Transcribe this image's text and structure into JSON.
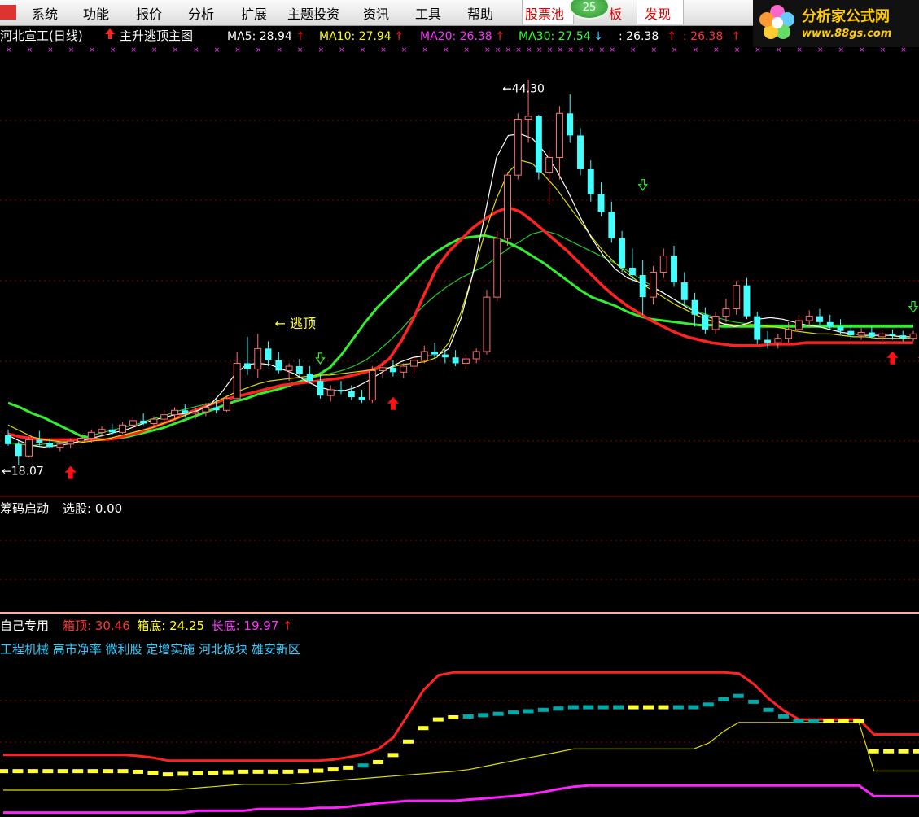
{
  "menubar": {
    "items": [
      "系统",
      "功能",
      "报价",
      "分析",
      "扩展",
      "主题投资",
      "资讯",
      "工具",
      "帮助",
      "股票池",
      "板",
      "发现"
    ],
    "badge": "25"
  },
  "logo": {
    "name": "分析家公式网",
    "url": "www.88gs.com"
  },
  "main_panel": {
    "title": "河北宣工(日线)",
    "indicator": "主升逃顶主图",
    "ma": [
      {
        "label": "MA5: 28.94",
        "arrow": "↑",
        "color": "#ffffff"
      },
      {
        "label": "MA10: 27.94",
        "arrow": "↑",
        "color": "#ffff00"
      },
      {
        "label": "MA20: 26.38",
        "arrow": "↑",
        "color": "#ff33ff"
      },
      {
        "label": "MA30: 27.54",
        "arrow": "↓",
        "color": "#33ff33"
      },
      {
        "label": ": 26.38",
        "arrow": "↑",
        "color": "#ffffff"
      },
      {
        "label": ": 26.38",
        "arrow": "↑",
        "color": "#ff3333"
      }
    ],
    "high_label": "44.30",
    "low_label": "18.07",
    "annotation": "← 逃顶"
  },
  "panel2": {
    "title": "筹码启动",
    "value_label": "选股: 0.00"
  },
  "panel3": {
    "title": "自己专用",
    "values": [
      {
        "label": "箱顶: 30.46",
        "color": "#ff3333"
      },
      {
        "label": "箱底: 24.25",
        "color": "#ffff00"
      },
      {
        "label": "长底: 19.97",
        "color": "#ff33ff"
      }
    ],
    "arrow": "↑",
    "tags": "工程机械 高市净率 微利股 定增实施 河北板块 雄安新区"
  },
  "colors": {
    "up": "#ff6666",
    "down": "#33ffff",
    "grid": "#8b0000",
    "text": "#dddddd"
  },
  "chart_data": [
    {
      "type": "candlestick",
      "title": "河北宣工(日线)",
      "ylim": [
        16.5,
        46.5
      ],
      "candles": [
        [
          20.1,
          20.5,
          19.4,
          19.5
        ],
        [
          19.5,
          19.7,
          18.07,
          18.7
        ],
        [
          18.7,
          20.0,
          18.6,
          19.8
        ],
        [
          19.8,
          20.4,
          19.4,
          19.6
        ],
        [
          19.6,
          19.9,
          19.2,
          19.3
        ],
        [
          19.3,
          19.7,
          19.0,
          19.5
        ],
        [
          19.5,
          19.9,
          19.2,
          19.7
        ],
        [
          19.7,
          20.2,
          19.5,
          19.9
        ],
        [
          19.9,
          20.5,
          19.6,
          20.3
        ],
        [
          20.3,
          20.7,
          20.0,
          20.5
        ],
        [
          20.5,
          20.9,
          20.1,
          20.3
        ],
        [
          20.3,
          21.0,
          20.2,
          20.8
        ],
        [
          20.8,
          21.3,
          20.5,
          21.1
        ],
        [
          21.1,
          21.6,
          20.8,
          20.9
        ],
        [
          20.9,
          21.4,
          20.6,
          21.2
        ],
        [
          21.2,
          21.8,
          20.9,
          21.5
        ],
        [
          21.5,
          22.0,
          21.2,
          21.8
        ],
        [
          21.8,
          22.2,
          21.3,
          21.6
        ],
        [
          21.6,
          22.0,
          21.2,
          21.7
        ],
        [
          21.7,
          22.3,
          21.4,
          22.0
        ],
        [
          22.0,
          22.6,
          21.6,
          21.8
        ],
        [
          21.8,
          22.8,
          21.7,
          22.6
        ],
        [
          22.6,
          25.8,
          22.4,
          25.0
        ],
        [
          25.0,
          26.8,
          24.2,
          24.6
        ],
        [
          24.6,
          27.0,
          24.0,
          26.0
        ],
        [
          26.0,
          26.5,
          24.8,
          25.2
        ],
        [
          25.2,
          25.8,
          24.3,
          24.5
        ],
        [
          24.5,
          25.0,
          23.8,
          24.8
        ],
        [
          24.8,
          25.3,
          24.1,
          24.3
        ],
        [
          24.3,
          24.8,
          23.6,
          23.8
        ],
        [
          23.8,
          24.3,
          22.6,
          22.8
        ],
        [
          22.8,
          23.5,
          22.4,
          23.2
        ],
        [
          23.2,
          23.8,
          22.9,
          23.1
        ],
        [
          23.1,
          23.5,
          22.5,
          22.7
        ],
        [
          22.7,
          23.2,
          22.3,
          22.5
        ],
        [
          22.5,
          24.8,
          22.3,
          24.5
        ],
        [
          24.5,
          25.0,
          24.0,
          24.7
        ],
        [
          24.7,
          25.2,
          24.1,
          24.4
        ],
        [
          24.4,
          25.0,
          24.0,
          24.8
        ],
        [
          24.8,
          25.5,
          24.3,
          25.2
        ],
        [
          25.2,
          26.2,
          25.0,
          25.8
        ],
        [
          25.8,
          26.4,
          25.3,
          25.6
        ],
        [
          25.6,
          26.0,
          25.0,
          25.4
        ],
        [
          25.4,
          25.9,
          24.8,
          25.0
        ],
        [
          25.0,
          25.6,
          24.6,
          25.3
        ],
        [
          25.3,
          26.0,
          25.0,
          25.8
        ],
        [
          25.8,
          30.0,
          25.6,
          29.5
        ],
        [
          29.5,
          34.0,
          29.2,
          33.5
        ],
        [
          33.5,
          38.0,
          33.0,
          37.8
        ],
        [
          37.8,
          42.0,
          37.5,
          41.6
        ],
        [
          41.6,
          44.3,
          40.0,
          41.8
        ],
        [
          41.8,
          41.9,
          37.5,
          38.0
        ],
        [
          38.0,
          39.5,
          35.8,
          39.0
        ],
        [
          39.0,
          42.5,
          37.5,
          42.0
        ],
        [
          42.0,
          43.3,
          40.0,
          40.5
        ],
        [
          40.5,
          41.0,
          37.8,
          38.2
        ],
        [
          38.2,
          38.8,
          36.0,
          36.5
        ],
        [
          36.5,
          37.3,
          35.0,
          35.3
        ],
        [
          35.3,
          36.0,
          33.2,
          33.5
        ],
        [
          33.5,
          34.0,
          31.2,
          31.5
        ],
        [
          31.5,
          32.8,
          30.5,
          31.0
        ],
        [
          31.0,
          32.0,
          28.3,
          29.5
        ],
        [
          29.5,
          31.6,
          29.0,
          31.2
        ],
        [
          31.2,
          32.8,
          30.8,
          32.3
        ],
        [
          32.3,
          33.0,
          30.2,
          30.5
        ],
        [
          30.5,
          31.2,
          29.0,
          29.3
        ],
        [
          29.3,
          29.8,
          27.5,
          28.3
        ],
        [
          28.3,
          28.8,
          27.0,
          27.3
        ],
        [
          27.3,
          28.5,
          27.0,
          28.2
        ],
        [
          28.2,
          29.4,
          27.8,
          28.7
        ],
        [
          28.7,
          30.6,
          28.3,
          30.3
        ],
        [
          30.3,
          30.8,
          28.0,
          28.2
        ],
        [
          28.2,
          28.5,
          26.3,
          26.6
        ],
        [
          26.6,
          27.2,
          26.0,
          26.4
        ],
        [
          26.4,
          27.0,
          26.0,
          26.7
        ],
        [
          26.7,
          27.8,
          26.4,
          27.3
        ],
        [
          27.3,
          28.3,
          27.0,
          27.9
        ],
        [
          27.9,
          28.6,
          27.4,
          28.2
        ],
        [
          28.2,
          28.7,
          27.6,
          27.8
        ],
        [
          27.8,
          28.3,
          27.3,
          27.5
        ],
        [
          27.5,
          28.0,
          27.0,
          27.2
        ],
        [
          27.2,
          27.6,
          26.6,
          26.9
        ],
        [
          26.9,
          27.4,
          26.6,
          27.1
        ],
        [
          27.1,
          27.5,
          26.7,
          26.8
        ],
        [
          26.8,
          27.3,
          26.5,
          27.0
        ],
        [
          27.0,
          27.3,
          26.6,
          26.9
        ],
        [
          26.9,
          27.2,
          26.5,
          26.7
        ],
        [
          26.7,
          27.2,
          26.5,
          27.0
        ]
      ],
      "ma5": [
        20.1,
        19.7,
        19.4,
        19.3,
        19.4,
        19.5,
        19.7,
        19.9,
        20.1,
        20.3,
        20.5,
        20.8,
        21.1,
        21.3,
        21.5,
        21.6,
        21.8,
        22.2,
        23.1,
        24.2,
        24.9,
        25.0,
        24.9,
        24.6,
        24.3,
        23.8,
        23.4,
        23.2,
        23.1,
        23.3,
        23.7,
        24.2,
        24.7,
        25.1,
        25.4,
        25.5,
        25.5,
        26.0,
        28.0,
        31.0,
        35.0,
        39.0,
        40.5,
        40.6,
        40.3,
        39.4,
        38.2,
        36.7,
        35.0,
        33.5,
        32.3,
        31.4,
        30.8,
        30.5,
        30.2,
        29.8,
        29.3,
        28.8,
        28.4,
        28.1,
        27.7,
        27.5,
        27.7,
        28.0,
        28.1,
        28.0,
        27.8,
        27.6,
        27.5,
        27.3,
        27.1,
        27.0,
        26.9,
        26.9,
        26.9,
        26.8,
        26.8
      ],
      "ma10": [
        20.8,
        20.4,
        20.0,
        19.8,
        19.7,
        19.6,
        19.6,
        19.7,
        19.8,
        20.0,
        20.2,
        20.4,
        20.6,
        20.9,
        21.2,
        21.5,
        21.8,
        22.2,
        22.6,
        23.0,
        23.3,
        23.6,
        23.8,
        23.9,
        24.0,
        24.1,
        24.2,
        24.2,
        24.3,
        24.4,
        24.5,
        24.6,
        24.7,
        24.9,
        25.0,
        25.1,
        25.4,
        26.4,
        28.4,
        31.0,
        33.8,
        36.2,
        38.0,
        38.8,
        38.6,
        37.8,
        36.9,
        35.8,
        34.7,
        33.6,
        32.6,
        31.8,
        31.1,
        30.5,
        30.0,
        29.5,
        29.0,
        28.6,
        28.2,
        27.9,
        27.7,
        27.6,
        27.6,
        27.6,
        27.5,
        27.4,
        27.2,
        27.1,
        27.0,
        27.0,
        26.9,
        26.8,
        26.8,
        26.7,
        26.7,
        26.7,
        26.7
      ],
      "ma20_red": [
        20.2,
        20.0,
        19.9,
        19.8,
        19.8,
        19.8,
        19.8,
        19.8,
        19.8,
        19.9,
        20.1,
        20.3,
        20.6,
        20.9,
        21.2,
        21.6,
        21.9,
        22.2,
        22.5,
        22.7,
        22.9,
        23.1,
        23.3,
        23.5,
        23.6,
        23.7,
        23.8,
        23.9,
        24.0,
        24.2,
        24.4,
        24.7,
        25.3,
        26.5,
        28.0,
        29.8,
        31.5,
        32.6,
        33.4,
        34.2,
        34.8,
        35.3,
        35.6,
        35.3,
        34.7,
        34.0,
        33.3,
        32.6,
        31.8,
        31.0,
        30.2,
        29.5,
        28.9,
        28.4,
        27.9,
        27.5,
        27.1,
        26.8,
        26.6,
        26.4,
        26.3,
        26.2,
        26.2,
        26.2,
        26.3,
        26.3,
        26.3,
        26.4,
        26.4,
        26.4,
        26.4,
        26.4,
        26.4,
        26.4,
        26.4,
        26.4,
        26.4
      ],
      "ma30_green": [
        22.3,
        22.0,
        21.6,
        21.3,
        20.9,
        20.5,
        20.1,
        19.9,
        19.8,
        19.9,
        20.0,
        20.2,
        20.4,
        20.6,
        20.9,
        21.2,
        21.5,
        21.8,
        22.1,
        22.4,
        22.6,
        22.9,
        23.1,
        23.3,
        23.6,
        23.9,
        24.2,
        24.7,
        25.6,
        26.7,
        27.8,
        28.8,
        29.6,
        30.4,
        31.2,
        32.0,
        32.6,
        33.1,
        33.5,
        33.6,
        33.7,
        33.5,
        33.2,
        32.8,
        32.3,
        31.8,
        31.2,
        30.6,
        30.0,
        29.5,
        29.2,
        28.9,
        28.5,
        28.2,
        28.0,
        27.9,
        27.8,
        27.7,
        27.6,
        27.6,
        27.5,
        27.5,
        27.5,
        27.5,
        27.5,
        27.5,
        27.5,
        27.5,
        27.5,
        27.5,
        27.5,
        27.5,
        27.5,
        27.5,
        27.5,
        27.5,
        27.5
      ],
      "ma_green_thin": [
        19.6,
        19.5,
        19.4,
        19.5,
        19.6,
        19.7,
        19.9,
        20.1,
        20.3,
        20.5,
        20.7,
        20.9,
        21.2,
        21.4,
        21.7,
        21.9,
        22.1,
        22.3,
        22.5,
        22.7,
        22.9,
        23.1,
        23.3,
        23.5,
        23.7,
        23.9,
        24.1,
        24.3,
        24.5,
        24.8,
        25.2,
        25.8,
        26.5,
        27.3,
        28.2,
        29.0,
        29.7,
        30.3,
        30.8,
        31.2,
        31.6,
        32.2,
        32.8,
        33.3,
        33.8,
        34.0,
        33.8,
        33.4,
        33.0,
        32.6,
        32.2,
        31.8,
        31.3,
        30.8,
        30.3,
        29.8,
        29.3,
        28.9,
        28.5,
        28.2,
        28.0,
        27.8,
        27.7,
        27.6,
        27.6,
        27.6,
        27.6,
        27.6,
        27.6,
        27.6,
        27.6,
        27.6,
        27.6,
        27.6,
        27.6,
        27.6,
        27.6
      ]
    },
    {
      "type": "line",
      "title": "自己专用",
      "ylim": [
        17.0,
        46.0
      ],
      "series": [
        {
          "name": "箱顶",
          "values": [
            27.0,
            27.0,
            27.0,
            27.0,
            27.0,
            27.0,
            27.0,
            27.0,
            27.0,
            26.8,
            26.5,
            26.0,
            26.0,
            26.0,
            26.0,
            26.0,
            26.0,
            26.0,
            26.0,
            26.0,
            26.0,
            26.0,
            26.2,
            26.6,
            27.1,
            28.0,
            30.0,
            34.0,
            38.0,
            40.5,
            41.0,
            41.0,
            41.0,
            41.0,
            41.0,
            41.0,
            41.0,
            41.0,
            41.0,
            41.0,
            41.0,
            41.0,
            41.0,
            41.0,
            41.0,
            41.0,
            41.0,
            41.0,
            41.0,
            40.8,
            39.0,
            36.5,
            34.5,
            33.0,
            33.0,
            33.0,
            33.0,
            33.0,
            30.46,
            30.46,
            30.46,
            30.46
          ]
        },
        {
          "name": "箱底",
          "values": [
            21.0,
            21.0,
            21.0,
            21.0,
            21.0,
            21.0,
            21.0,
            21.0,
            21.0,
            21.0,
            21.0,
            21.0,
            21.2,
            21.4,
            21.6,
            21.8,
            22.0,
            22.0,
            22.0,
            22.0,
            22.2,
            22.4,
            22.6,
            22.8,
            23.0,
            23.2,
            23.4,
            23.6,
            23.8,
            24.0,
            24.2,
            24.5,
            25.0,
            25.5,
            26.0,
            26.5,
            27.0,
            27.5,
            28.0,
            28.0,
            28.0,
            28.0,
            28.0,
            28.0,
            28.0,
            28.0,
            28.0,
            29.0,
            31.0,
            32.5,
            32.5,
            32.5,
            32.5,
            32.5,
            32.5,
            32.5,
            32.5,
            32.5,
            24.25,
            24.25,
            24.25,
            24.25
          ]
        },
        {
          "name": "长底",
          "values": [
            17.2,
            17.2,
            17.2,
            17.2,
            17.2,
            17.2,
            17.2,
            17.2,
            17.2,
            17.2,
            17.2,
            17.2,
            17.2,
            17.5,
            17.5,
            17.5,
            17.5,
            17.8,
            17.8,
            17.8,
            17.8,
            18.0,
            18.0,
            18.2,
            18.5,
            18.8,
            19.0,
            19.2,
            19.2,
            19.2,
            19.2,
            19.4,
            19.6,
            19.8,
            20.0,
            20.3,
            20.7,
            21.2,
            21.6,
            21.8,
            21.8,
            21.8,
            21.8,
            21.8,
            21.8,
            21.8,
            21.8,
            21.8,
            21.8,
            21.8,
            21.8,
            21.8,
            21.8,
            21.8,
            21.8,
            21.8,
            21.8,
            21.8,
            19.97,
            19.97,
            19.97,
            19.97
          ]
        }
      ]
    }
  ]
}
